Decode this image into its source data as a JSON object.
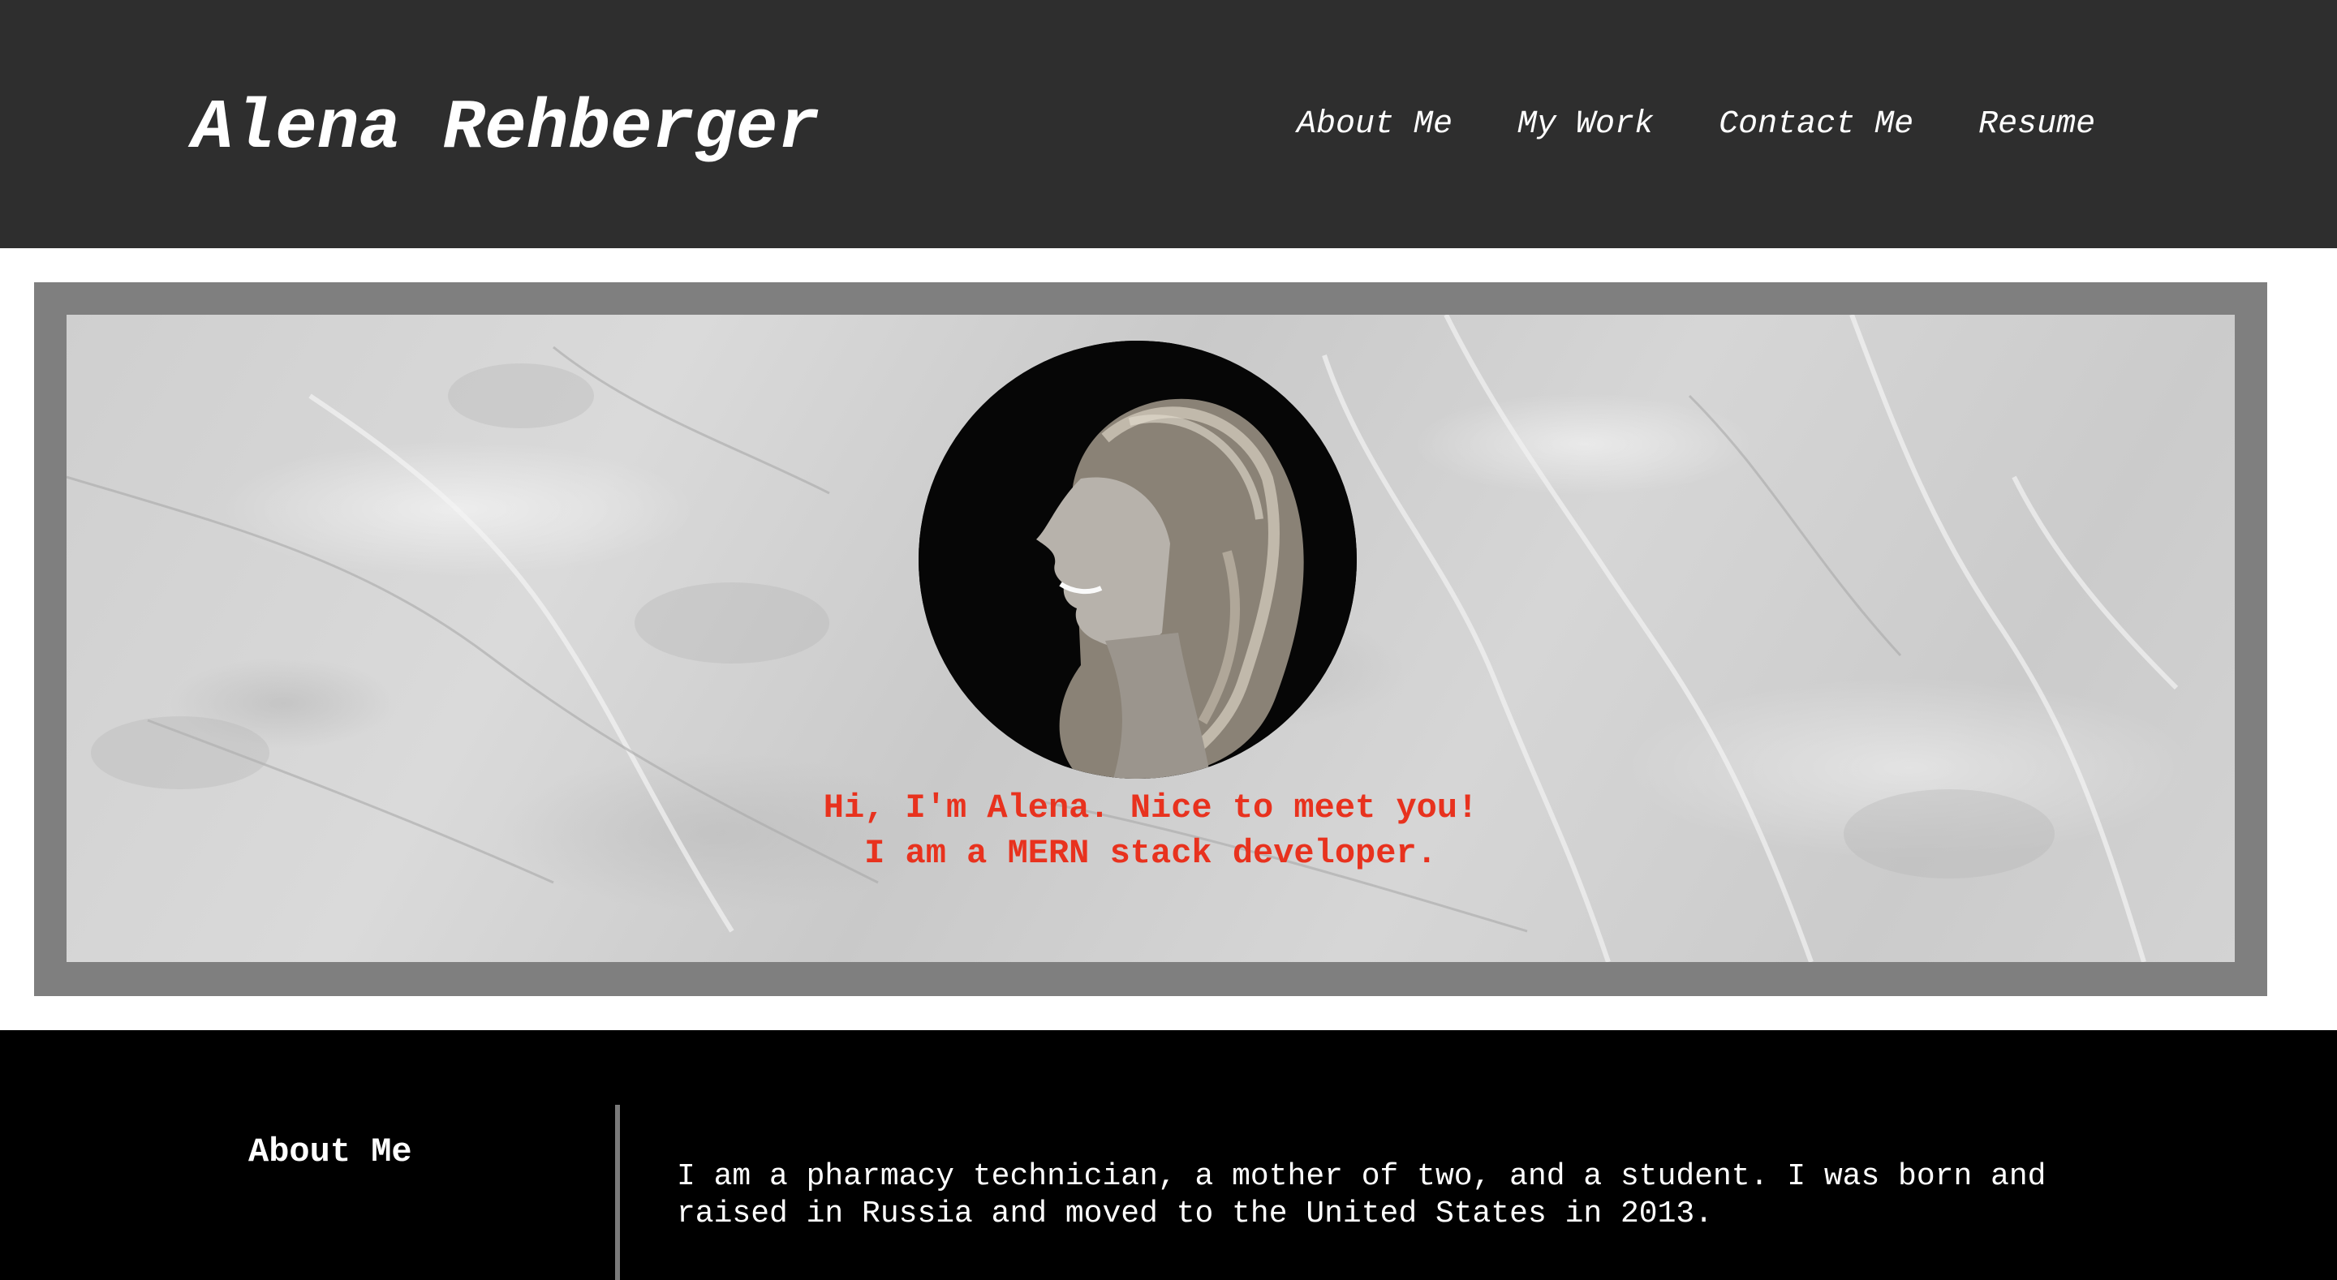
{
  "header": {
    "title": "Alena Rehberger",
    "nav": [
      "About Me",
      "My Work",
      "Contact Me",
      "Resume"
    ]
  },
  "hero": {
    "greeting_line1": "Hi, I'm Alena. Nice to meet you!",
    "greeting_line2": "I am a MERN stack developer.",
    "accent_color": "#e8321e"
  },
  "about": {
    "heading": "About Me",
    "paragraph": "I am a pharmacy technician, a mother of two, and a student. I was born and raised in Russia and moved to the United States in 2013."
  },
  "colors": {
    "header_bg": "#2e2e2e",
    "hero_frame": "#7f7f7f",
    "about_bg": "#000000"
  }
}
